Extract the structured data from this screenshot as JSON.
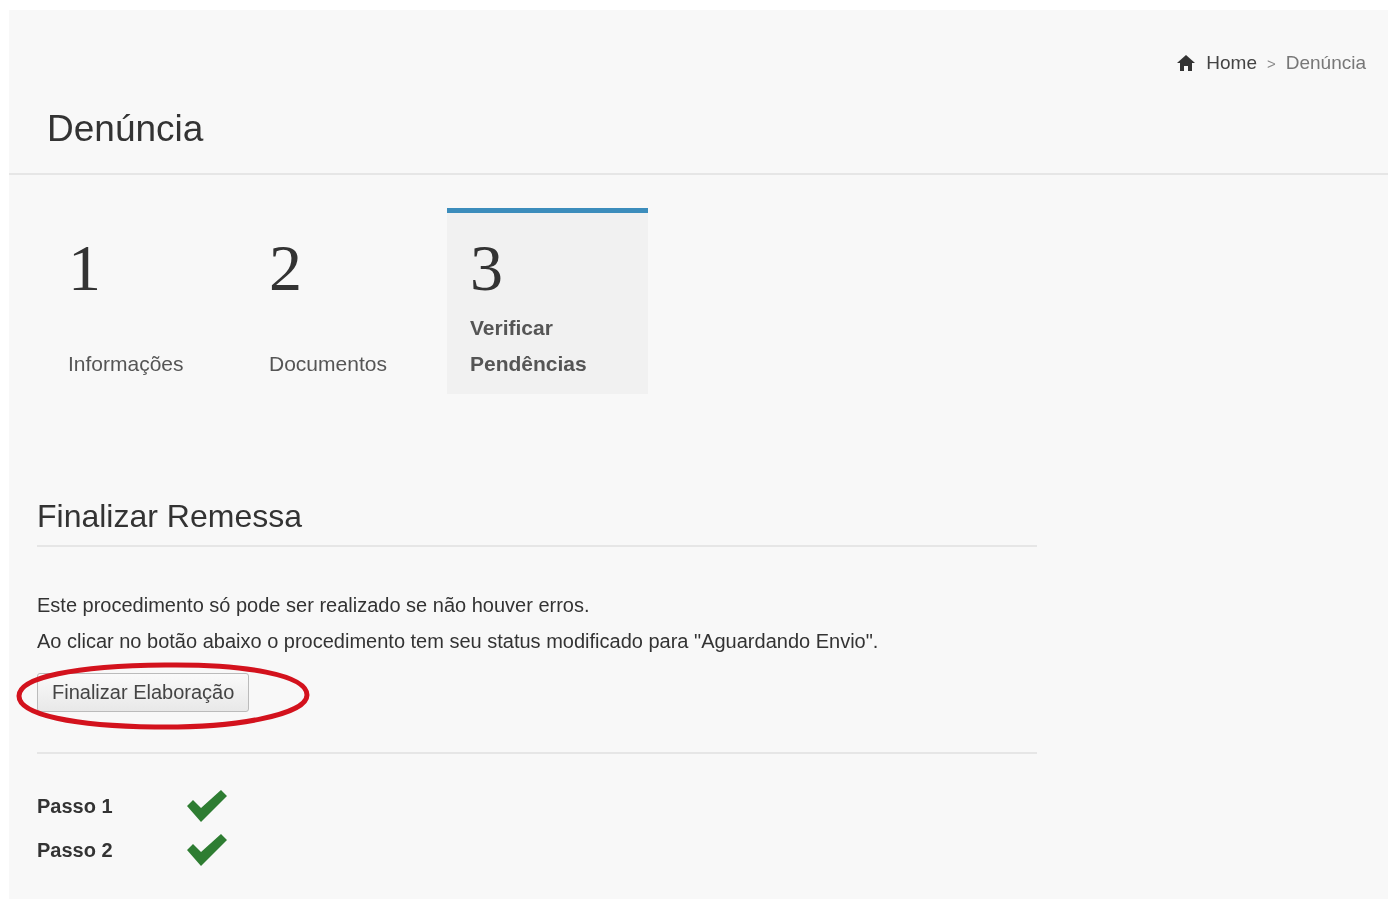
{
  "breadcrumb": [
    {
      "label": "Home",
      "kind": "home"
    },
    {
      "label": "Denúncia",
      "kind": "current"
    }
  ],
  "breadcrumb_separator": ">",
  "page_title": "Denúncia",
  "steps": [
    {
      "number": "1",
      "label": "Informações",
      "selected": false
    },
    {
      "number": "2",
      "label": "Documentos",
      "selected": false
    },
    {
      "number": "3",
      "label": "Verificar Pendências",
      "selected": true
    }
  ],
  "section": {
    "title": "Finalizar Remessa",
    "paragraphs": [
      "Este procedimento só pode ser realizado se não houver erros.",
      "Ao clicar no botão abaixo o procedimento tem seu status modificado para \"Aguardando Envio\"."
    ],
    "button": "Finalizar Elaboração",
    "annotation": {
      "kind": "ellipse"
    }
  },
  "checks": [
    {
      "label": "Passo 1",
      "done": true
    },
    {
      "label": "Passo 2",
      "done": true
    }
  ]
}
